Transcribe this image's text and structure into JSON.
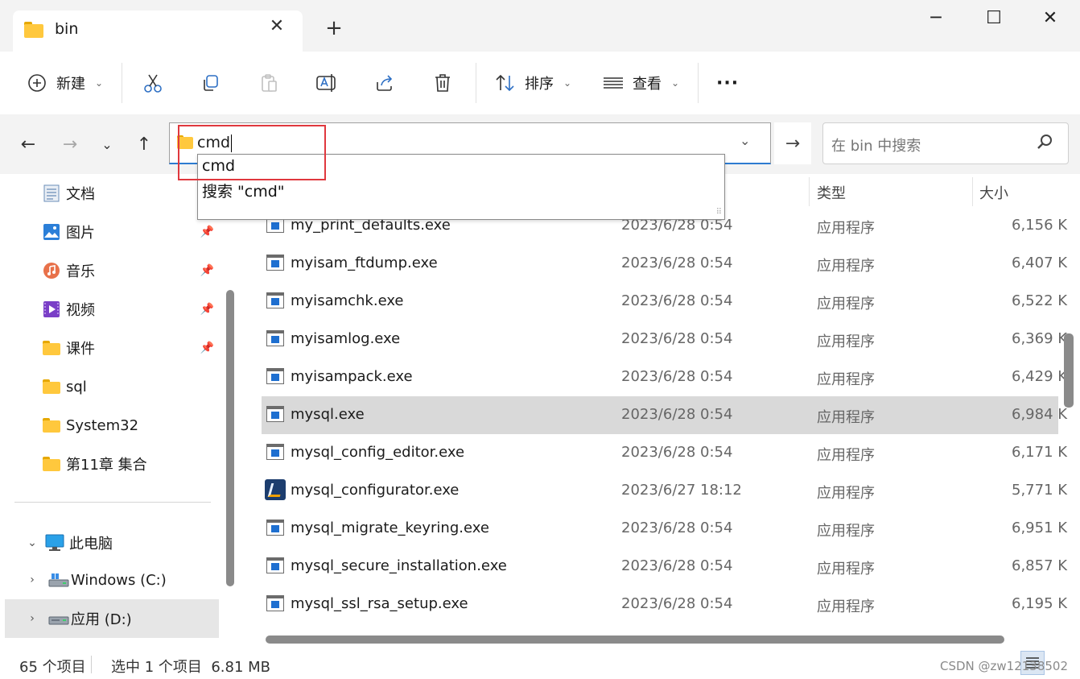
{
  "window": {
    "tab_title": "bin",
    "new_tab_label": "+",
    "minimize_label": "─",
    "maximize_label": "☐",
    "close_label": "✕"
  },
  "toolbar": {
    "new_label": "新建",
    "sort_label": "排序",
    "view_label": "查看",
    "more_label": "···"
  },
  "address": {
    "value": "cmd",
    "dropdown_suggestions": [
      "cmd",
      "搜索 \"cmd\""
    ]
  },
  "search": {
    "placeholder": "在 bin 中搜索"
  },
  "sidebar": {
    "quick_access": [
      {
        "label": "文档",
        "icon": "document-icon",
        "pinned": false
      },
      {
        "label": "图片",
        "icon": "pictures-icon",
        "pinned": true
      },
      {
        "label": "音乐",
        "icon": "music-icon",
        "pinned": true
      },
      {
        "label": "视频",
        "icon": "video-icon",
        "pinned": true
      },
      {
        "label": "课件",
        "icon": "folder-icon",
        "pinned": true
      },
      {
        "label": "sql",
        "icon": "folder-icon",
        "pinned": false
      },
      {
        "label": "System32",
        "icon": "folder-icon",
        "pinned": false
      },
      {
        "label": "第11章 集合",
        "icon": "folder-icon",
        "pinned": false
      }
    ],
    "this_pc": "此电脑",
    "drives": [
      {
        "label": "Windows (C:)",
        "icon": "system-drive-icon"
      },
      {
        "label": "应用 (D:)",
        "icon": "drive-icon",
        "selected": true
      }
    ]
  },
  "columns": {
    "type": "类型",
    "size": "大小"
  },
  "files": [
    {
      "name": "my_print_defaults.exe",
      "date": "2023/6/28 0:54",
      "type": "应用程序",
      "size": "6,156 K"
    },
    {
      "name": "myisam_ftdump.exe",
      "date": "2023/6/28 0:54",
      "type": "应用程序",
      "size": "6,407 K"
    },
    {
      "name": "myisamchk.exe",
      "date": "2023/6/28 0:54",
      "type": "应用程序",
      "size": "6,522 K"
    },
    {
      "name": "myisamlog.exe",
      "date": "2023/6/28 0:54",
      "type": "应用程序",
      "size": "6,369 K"
    },
    {
      "name": "myisampack.exe",
      "date": "2023/6/28 0:54",
      "type": "应用程序",
      "size": "6,429 K"
    },
    {
      "name": "mysql.exe",
      "date": "2023/6/28 0:54",
      "type": "应用程序",
      "size": "6,984 K",
      "selected": true
    },
    {
      "name": "mysql_config_editor.exe",
      "date": "2023/6/28 0:54",
      "type": "应用程序",
      "size": "6,171 K"
    },
    {
      "name": "mysql_configurator.exe",
      "date": "2023/6/27 18:12",
      "type": "应用程序",
      "size": "5,771 K",
      "icon": "configurator-icon"
    },
    {
      "name": "mysql_migrate_keyring.exe",
      "date": "2023/6/28 0:54",
      "type": "应用程序",
      "size": "6,951 K"
    },
    {
      "name": "mysql_secure_installation.exe",
      "date": "2023/6/28 0:54",
      "type": "应用程序",
      "size": "6,857 K"
    },
    {
      "name": "mysql_ssl_rsa_setup.exe",
      "date": "2023/6/28 0:54",
      "type": "应用程序",
      "size": "6,195 K"
    }
  ],
  "status": {
    "item_count": "65 个项目",
    "selection": "选中 1 个项目  6.81 MB"
  },
  "watermark": "CSDN @zw12138502",
  "colors": {
    "accent": "#2d7bd0",
    "highlight_box": "#e0383e",
    "selected_row": "#d9d9d9"
  }
}
